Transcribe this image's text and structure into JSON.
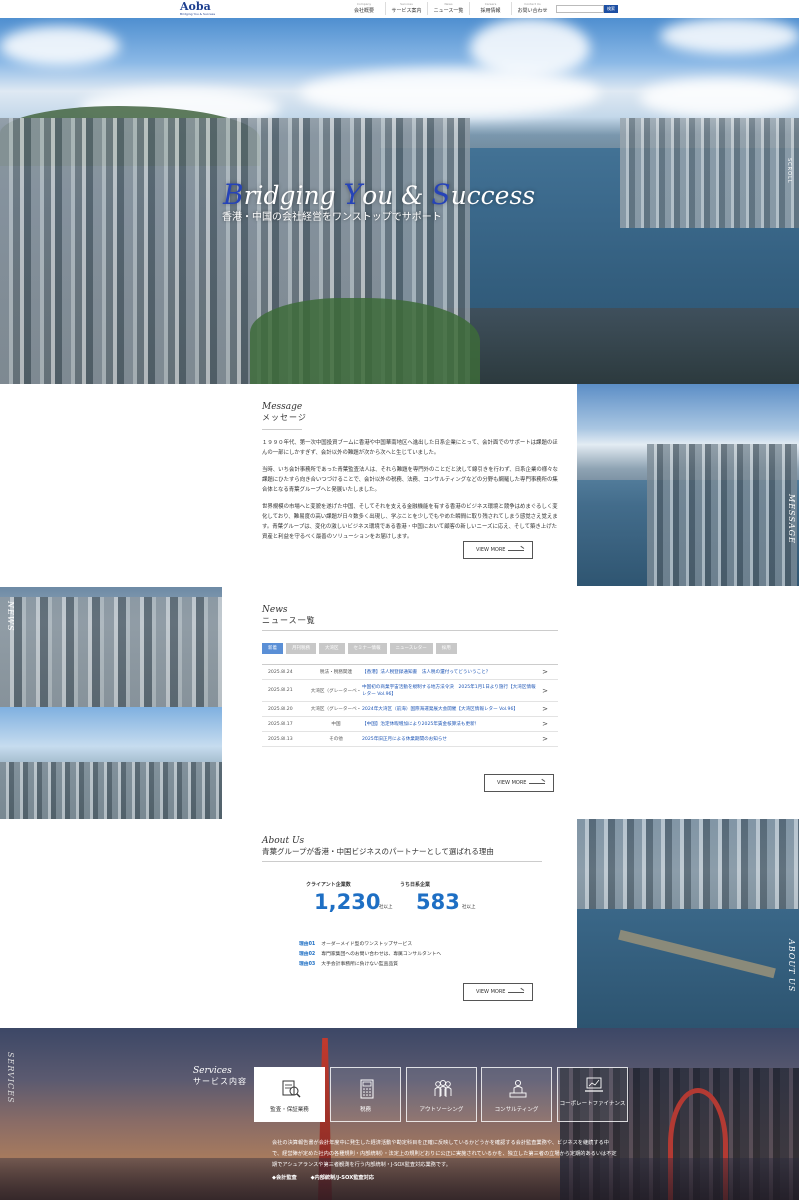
{
  "header": {
    "logo": "Aoba",
    "logo_sub": "Bridging You & Success",
    "nav": [
      {
        "en": "Company",
        "ja": "会社概要"
      },
      {
        "en": "Services",
        "ja": "サービス案内"
      },
      {
        "en": "News",
        "ja": "ニュース一覧"
      },
      {
        "en": "Careers",
        "ja": "採用情報"
      },
      {
        "en": "Contact Us",
        "ja": "お問い合わせ"
      }
    ],
    "search_placeholder": "",
    "search_button": "検索"
  },
  "hero": {
    "title_parts": [
      "B",
      "ridging ",
      "Y",
      "ou & ",
      "S",
      "uccess"
    ],
    "subtitle": "香港・中国の会社経営をワンストップでサポート",
    "scroll": "SCROLL"
  },
  "message": {
    "title_en": "Message",
    "title_ja": "メッセージ",
    "paragraphs": [
      "１９９０年代、第一次中国投資ブームに香港や中国華南地区へ進出した日系企業にとって、会計面でのサポートは課題のほんの一部にしかすぎず、会計以外の難題が次から次へと生じていました。",
      "当時、いち会計事務所であった青葉監査法人は、それら難題を専門外のことだと決して線引きを行わず、日系企業の様々な課題にひたすら向き合いつづけることで、会計以外の税務、法務、コンサルティングなどの分野も網羅した専門事務所の集合体となる青葉グループへと発展いたしました。",
      "世界規模の市場へと変貌を遂げた中国、そしてそれを支える金融機能を有する香港のビジネス環境と競争はめまぐるしく変化しており、難易度の高い課題が日々数多く出現し、学ぶことを少しでもやめた瞬間に取り残されてしまう感覚さえ覚えます。青葉グループは、変化の激しいビジネス環境である香港・中国において顧客の新しいニーズに応え、そして築き上げた資産と利益を守るべく最善のソリューションをお届けします。"
    ],
    "view_more": "VIEW MORE",
    "photo_label": "MESSAGE"
  },
  "news": {
    "title_en": "News",
    "title_ja": "ニュース一覧",
    "tabs": [
      "新着",
      "月刊税務",
      "大湾区",
      "セミナー情報",
      "ニュースレター",
      "採用"
    ],
    "items": [
      {
        "date": "2025.8l.24",
        "category": "税法・税務関連",
        "title": "【香港】法人税登録通知書　法人税の還付ってどういうこと？"
      },
      {
        "date": "2025.8l.21",
        "category": "大湾区（グレーターベ・",
        "title": "中国初の商業宇宙活動を規制する地方法令決　2025年1月1日より施行【大湾区情報レター Vol.96】"
      },
      {
        "date": "2025.8l.20",
        "category": "大湾区（グレーターベ・",
        "title": "2024年大湾区（前海）国際海運発展大会開催【大湾区情報レター Vol.96】"
      },
      {
        "date": "2025.8l.17",
        "category": "中国",
        "title": "【中国】治定休暇増加により2025年賃金核算法も更新！"
      },
      {
        "date": "2025.8l.13",
        "category": "その他",
        "title": "2025年旧正月による休業期間のお知らせ"
      }
    ],
    "view_more": "VIEW MORE",
    "photo_label": "NEWS"
  },
  "about": {
    "title_en": "About Us",
    "title_ja": "青葉グループが香港・中国ビジネスのパートナーとして選ばれる理由",
    "stats": [
      {
        "label": "クライアント企業数",
        "value": "1,230",
        "unit": "社以上"
      },
      {
        "label": "うち日系企業",
        "value": "583",
        "unit": "社以上"
      }
    ],
    "reasons": [
      {
        "no": "理由01",
        "text": "オーダーメイド型のワンストップサービス"
      },
      {
        "no": "理由02",
        "text": "専門家集団へのお問い合わせは、専属コンサルタントへ"
      },
      {
        "no": "理由03",
        "text": "大手会計事務所に負けない監査品質"
      }
    ],
    "view_more": "VIEW MORE",
    "photo_label": "ABOUT US"
  },
  "services": {
    "title_en": "Services",
    "title_ja": "サービス内容",
    "vertical_label": "SERVICES",
    "cards": [
      {
        "label": "監査・保証業務",
        "icon": "magnifier-document-icon"
      },
      {
        "label": "税務",
        "icon": "calculator-icon"
      },
      {
        "label": "アウトソーシング",
        "icon": "people-group-icon"
      },
      {
        "label": "コンサルティング",
        "icon": "presenter-icon"
      },
      {
        "label": "コーポレートファイナンス",
        "icon": "laptop-icon"
      }
    ],
    "description": "会社の決算報告書が会計年度中に発生した経済活動や勘定科目を正確に反映しているかどうかを確認する会計監査業務や、ビジネスを継続する中で、経営陣が定めた社内の各種規則・内部統制）・法定上の規則どおりに公正に実施されているかを、独立した第三者の立場から定期的あるいは不定期でアシュアランスや第三者観測を行う内部統制・J-SOX監査対応業務です。",
    "bullets": [
      "◆会計監査",
      "◆内部統制/J-SOX監査対応"
    ]
  },
  "colors": {
    "brand": "#1d3f8f",
    "accent": "#1e6fc4",
    "link": "#1d55b5",
    "tab_active": "#5a8fd6"
  }
}
